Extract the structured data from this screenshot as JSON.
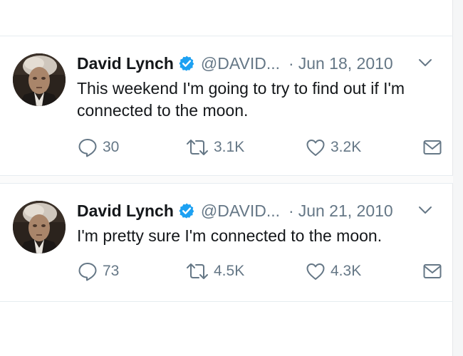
{
  "tweets": [
    {
      "name": "David Lynch",
      "handle": "@DAVID...",
      "separator": "·",
      "date": "Jun 18, 2010",
      "text": "This weekend I'm going to try to find out if I'm connected to the moon.",
      "replies": "30",
      "retweets": "3.1K",
      "likes": "3.2K"
    },
    {
      "name": "David Lynch",
      "handle": "@DAVID...",
      "separator": "·",
      "date": "Jun 21, 2010",
      "text": "I'm pretty sure I'm connected to the moon.",
      "replies": "73",
      "retweets": "4.5K",
      "likes": "4.3K"
    }
  ],
  "colors": {
    "text": "#14171a",
    "muted": "#657786",
    "verified": "#1da1f2",
    "divider": "#e6ecf0"
  },
  "icons": {
    "verified": "verified-badge-icon",
    "caret": "chevron-down-icon",
    "reply": "reply-icon",
    "retweet": "retweet-icon",
    "like": "heart-icon",
    "message": "envelope-icon"
  }
}
